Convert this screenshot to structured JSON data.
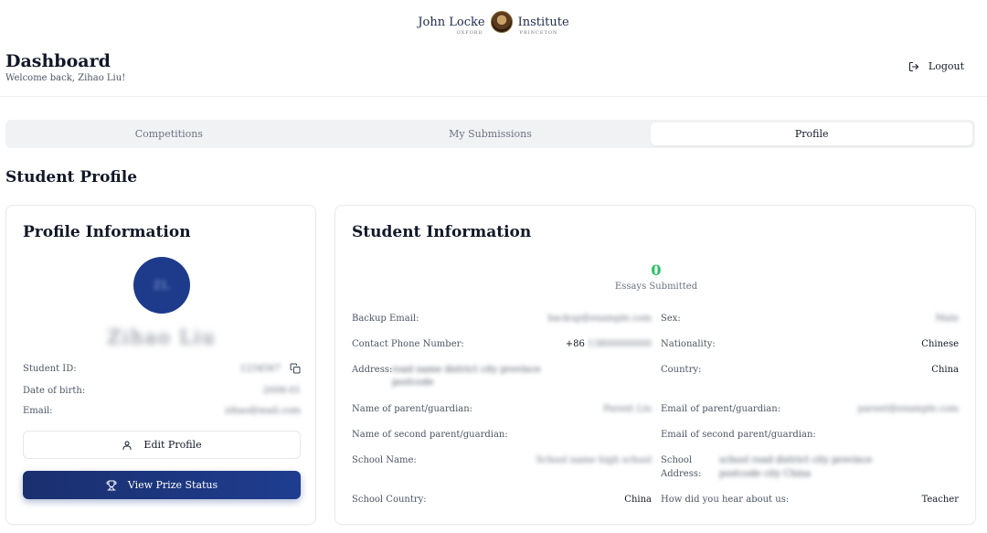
{
  "header": {
    "logo_left": "John Locke",
    "logo_right": "Institute",
    "logo_sub_left": "OXFORD",
    "logo_sub_right": "PRINCETON"
  },
  "dashboard": {
    "title": "Dashboard",
    "welcome": "Welcome back, Zihao Liu!",
    "logout_label": "Logout"
  },
  "tabs": [
    {
      "label": "Competitions",
      "active": false
    },
    {
      "label": "My Submissions",
      "active": false
    },
    {
      "label": "Profile",
      "active": true
    }
  ],
  "section_title": "Student Profile",
  "profile": {
    "card_title": "Profile Information",
    "avatar_initials": "ZL",
    "name": "Zihao Liu",
    "student_id_label": "Student ID:",
    "student_id_value": "1234567",
    "dob_label": "Date of birth:",
    "dob_value": "2008-01",
    "email_label": "Email:",
    "email_value": "zihao@mail.com",
    "edit_button": "Edit Profile",
    "prize_button": "View Prize Status"
  },
  "student_info": {
    "card_title": "Student Information",
    "essays_count": "0",
    "essays_label": "Essays Submitted",
    "fields_left": [
      {
        "label": "Backup Email:",
        "value": "backup@example.com",
        "blurred": true
      },
      {
        "label": "Contact Phone Number:",
        "value_prefix": "+86",
        "value": "13800000000",
        "blurred": true
      },
      {
        "label": "Address:",
        "value": "road name district city province",
        "value2": "postcode",
        "blurred": true
      },
      {
        "label": "Name of parent/guardian:",
        "value": "Parent Liu",
        "blurred": true
      },
      {
        "label": "Name of second parent/guardian:",
        "value": "",
        "blurred": false
      },
      {
        "label": "School Name:",
        "value": "School name high school",
        "blurred": true
      },
      {
        "label": "School Country:",
        "value": "China",
        "blurred": false
      }
    ],
    "fields_right": [
      {
        "label": "Sex:",
        "value": "Male",
        "blurred": true
      },
      {
        "label": "Nationality:",
        "value": "Chinese",
        "blurred": false
      },
      {
        "label": "Country:",
        "value": "China",
        "blurred": false
      },
      {
        "label": "Email of parent/guardian:",
        "value": "parent@example.com",
        "blurred": true
      },
      {
        "label": "Email of second parent/guardian:",
        "value": "",
        "blurred": false
      },
      {
        "label": "School",
        "label2": "Address:",
        "value": "school road district city province",
        "value2": "postcode city China",
        "blurred": true
      },
      {
        "label": "How did you hear about us:",
        "value": "Teacher",
        "blurred": false
      }
    ]
  },
  "colors": {
    "primary": "#1e3a8a",
    "success": "#22c55e",
    "tab_bg": "#f1f2f4"
  }
}
